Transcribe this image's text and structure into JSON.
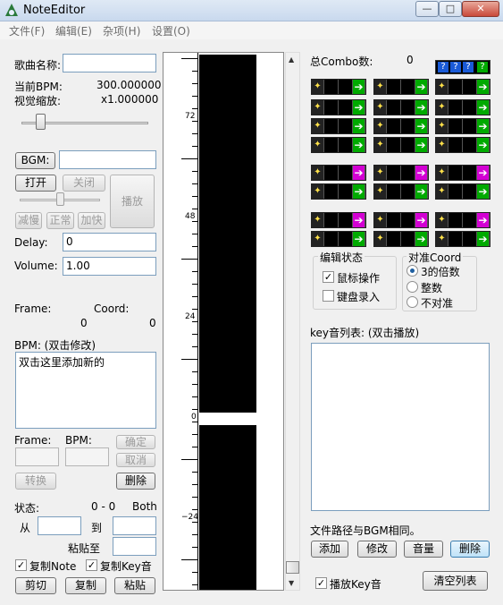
{
  "window": {
    "title": "NoteEditor",
    "minimize": "—",
    "maximize": "□",
    "close": "✕"
  },
  "menu": [
    "文件(F)",
    "编辑(E)",
    "杂项(H)",
    "设置(O)"
  ],
  "left": {
    "song_label": "歌曲名称:",
    "song_value": "",
    "bpm_label": "当前BPM:",
    "bpm_value": "300.000000",
    "zoom_label": "视觉缩放:",
    "zoom_value": "x1.000000",
    "bgm_button": "BGM:",
    "bgm_value": "",
    "open": "打开",
    "close": "关闭",
    "play": "播放",
    "slow": "减慢",
    "normal": "正常",
    "fast": "加快",
    "delay_label": "Delay:",
    "delay_value": "0",
    "volume_label": "Volume:",
    "volume_value": "1.00",
    "frame_label": "Frame:",
    "coord_label": "Coord:",
    "frame_value": "0",
    "coord_value": "0",
    "bpm_list_label": "BPM: (双击修改)",
    "bpm_list_item": "双击这里添加新的",
    "frame2_label": "Frame:",
    "bpm2_label": "BPM:",
    "confirm": "确定",
    "cancel": "取消",
    "convert": "转换",
    "delete": "删除",
    "state_label": "状态:",
    "state_value": "0 - 0",
    "state_mode": "Both",
    "from_label": "从",
    "to_label": "到",
    "paste_to_label": "粘贴至",
    "copy_note": "复制Note",
    "copy_key": "复制Key音",
    "cut": "剪切",
    "copy": "复制",
    "paste": "粘贴"
  },
  "timeline": {
    "ticks": [
      "72",
      "48",
      "24",
      "0",
      "−24"
    ]
  },
  "right": {
    "combo_label": "总Combo数:",
    "combo_value": "0",
    "edit_state_title": "编辑状态",
    "mouse_op": "鼠标操作",
    "keyboard_rec": "键盘录入",
    "coord_title": "对准Coord",
    "coord_opts": [
      "3的倍数",
      "整数",
      "不对准"
    ],
    "key_list_label": "key音列表: (双击播放)",
    "path_note": "文件路径与BGM相同。",
    "add": "添加",
    "modify": "修改",
    "volume": "音量",
    "delete": "删除",
    "play_key": "播放Key音",
    "clear_list": "清空列表"
  },
  "colors": {
    "accent": "#3c7fb1",
    "note_green": "#00aa00",
    "note_pink": "#d300d3"
  }
}
